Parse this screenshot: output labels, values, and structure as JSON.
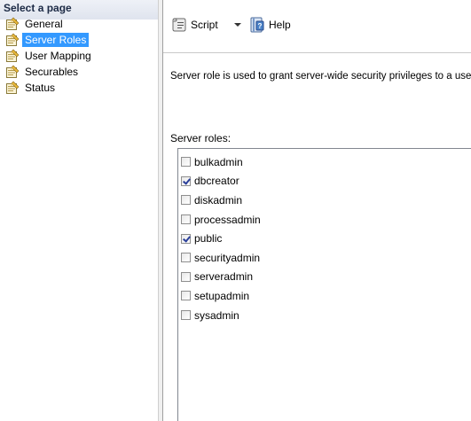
{
  "nav": {
    "header": "Select a page",
    "items": [
      {
        "label": "General",
        "icon": "page-icon",
        "selected": false
      },
      {
        "label": "Server Roles",
        "icon": "page-icon",
        "selected": true
      },
      {
        "label": "User Mapping",
        "icon": "page-icon",
        "selected": false
      },
      {
        "label": "Securables",
        "icon": "page-icon",
        "selected": false
      },
      {
        "label": "Status",
        "icon": "page-icon",
        "selected": false
      }
    ]
  },
  "toolbar": {
    "script_label": "Script",
    "help_label": "Help"
  },
  "content": {
    "description": "Server role is used to grant server-wide security privileges to a user.",
    "roles_label": "Server roles:",
    "roles": [
      {
        "name": "bulkadmin",
        "checked": false
      },
      {
        "name": "dbcreator",
        "checked": true
      },
      {
        "name": "diskadmin",
        "checked": false
      },
      {
        "name": "processadmin",
        "checked": false
      },
      {
        "name": "public",
        "checked": true
      },
      {
        "name": "securityadmin",
        "checked": false
      },
      {
        "name": "serveradmin",
        "checked": false
      },
      {
        "name": "setupadmin",
        "checked": false
      },
      {
        "name": "sysadmin",
        "checked": false
      }
    ]
  },
  "colors": {
    "selection": "#3399ff",
    "header_bg": "#dfe4ee"
  }
}
